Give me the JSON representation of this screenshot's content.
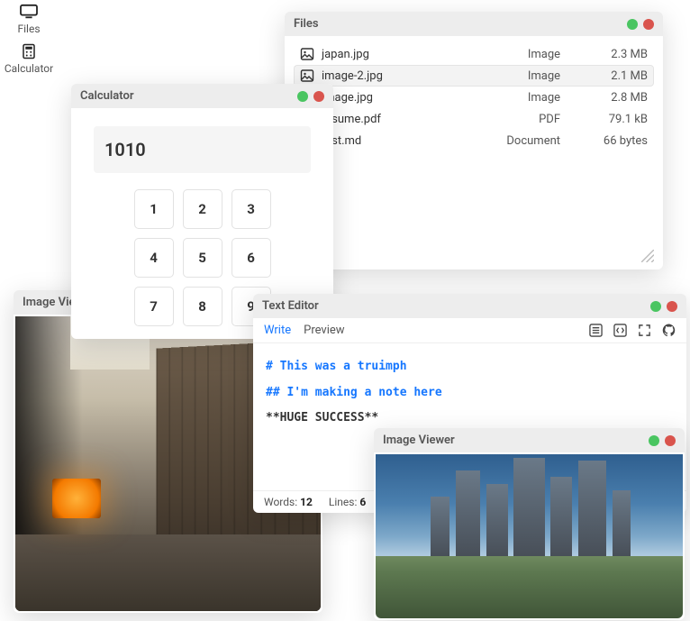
{
  "desktop": {
    "icons": [
      {
        "name": "files-app-icon",
        "label": "Files"
      },
      {
        "name": "calculator-app-icon",
        "label": "Calculator"
      }
    ]
  },
  "windows": {
    "files": {
      "title": "Files",
      "rows": [
        {
          "icon": "image-icon",
          "name": "japan.jpg",
          "type": "Image",
          "size": "2.3 MB",
          "selected": false
        },
        {
          "icon": "image-icon",
          "name": "image-2.jpg",
          "type": "Image",
          "size": "2.1 MB",
          "selected": true
        },
        {
          "icon": "image-icon",
          "name": "image.jpg",
          "type": "Image",
          "size": "2.8 MB",
          "selected": false
        },
        {
          "icon": "file-icon",
          "name": "resume.pdf",
          "type": "PDF",
          "size": "79.1 kB",
          "selected": false
        },
        {
          "icon": "file-icon",
          "name": "test.md",
          "type": "Document",
          "size": "66 bytes",
          "selected": false
        }
      ]
    },
    "calculator": {
      "title": "Calculator",
      "display": "1010",
      "buttons": [
        "1",
        "2",
        "3",
        "4",
        "5",
        "6",
        "7",
        "8",
        "9"
      ]
    },
    "imageViewerA": {
      "title": "Image View"
    },
    "imageViewerB": {
      "title": "Image Viewer"
    },
    "editor": {
      "title": "Text Editor",
      "tabs": {
        "write": "Write",
        "preview": "Preview"
      },
      "content": {
        "line1": "# This was a truimph",
        "line2": "## I'm making a note here",
        "line3": "**HUGE SUCCESS**"
      },
      "status": {
        "words_label": "Words:",
        "words": "12",
        "lines_label": "Lines:",
        "lines": "6"
      }
    }
  }
}
